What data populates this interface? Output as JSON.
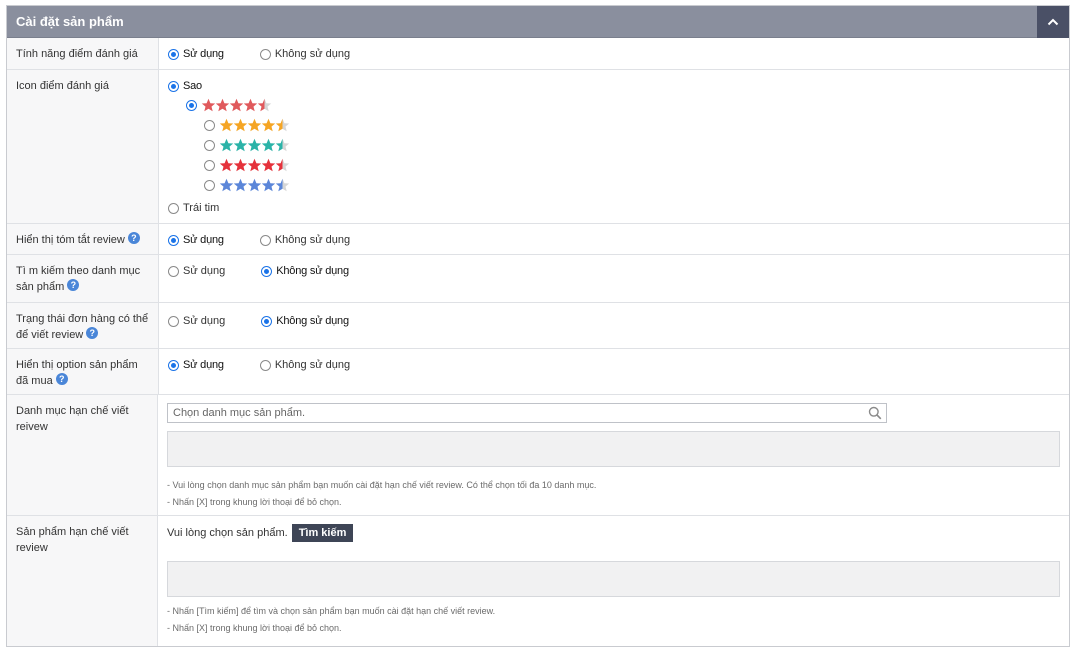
{
  "panel": {
    "title": "Cài đặt sản phẩm",
    "collapse_icon": "chevron-up-icon"
  },
  "rating_feature": {
    "label": "Tính năng điểm đánh giá",
    "use": "Sử dụng",
    "not_use": "Không sử dụng",
    "selected": "use"
  },
  "rating_icon": {
    "label": "Icon điểm đánh giá",
    "star_option": "Sao",
    "heart_option": "Trái tim",
    "selected": "star",
    "star_colors": [
      "#e0595c",
      "#f5a524",
      "#2bb3a8",
      "#e5323b",
      "#5b86d9"
    ],
    "selected_style": 0,
    "rating": 4.5
  },
  "review_summary": {
    "label": "Hiển thị tóm tắt review",
    "use": "Sử dụng",
    "not_use": "Không sử dụng",
    "selected": "use"
  },
  "category_search": {
    "label": "Tì m kiếm theo danh mục sản phẩm",
    "use": "Sử dụng",
    "not_use": "Không sử dụng",
    "selected": "not_use"
  },
  "order_status": {
    "label": "Trạng thái đơn hàng có thể để viết review",
    "use": "Sử dụng",
    "not_use": "Không sử dụng",
    "selected": "not_use"
  },
  "purchased_option": {
    "label": "Hiển thị option sản phẩm đã mua",
    "use": "Sử dụng",
    "not_use": "Không sử dụng",
    "selected": "use"
  },
  "category_restrict": {
    "label": "Danh mục hạn chế viết reivew",
    "placeholder": "Chọn danh mục sản phẩm.",
    "notes": [
      "Vui lòng chọn danh mục sản phẩm bạn muốn cài đặt hạn chế viết review. Có thể chọn tối đa 10 danh mục.",
      "Nhấn [X] trong khung lời thoại để bỏ chọn."
    ]
  },
  "product_restrict": {
    "label": "Sản phẩm hạn chế viết review",
    "prompt": "Vui lòng chọn sản phẩm.",
    "search_button": "Tìm kiếm",
    "notes": [
      "Nhấn [Tìm kiếm] để tìm và chọn sản phẩm bạn muốn cài đặt hạn chế viết review.",
      "Nhấn [X] trong khung lời thoại để bỏ chọn."
    ]
  }
}
